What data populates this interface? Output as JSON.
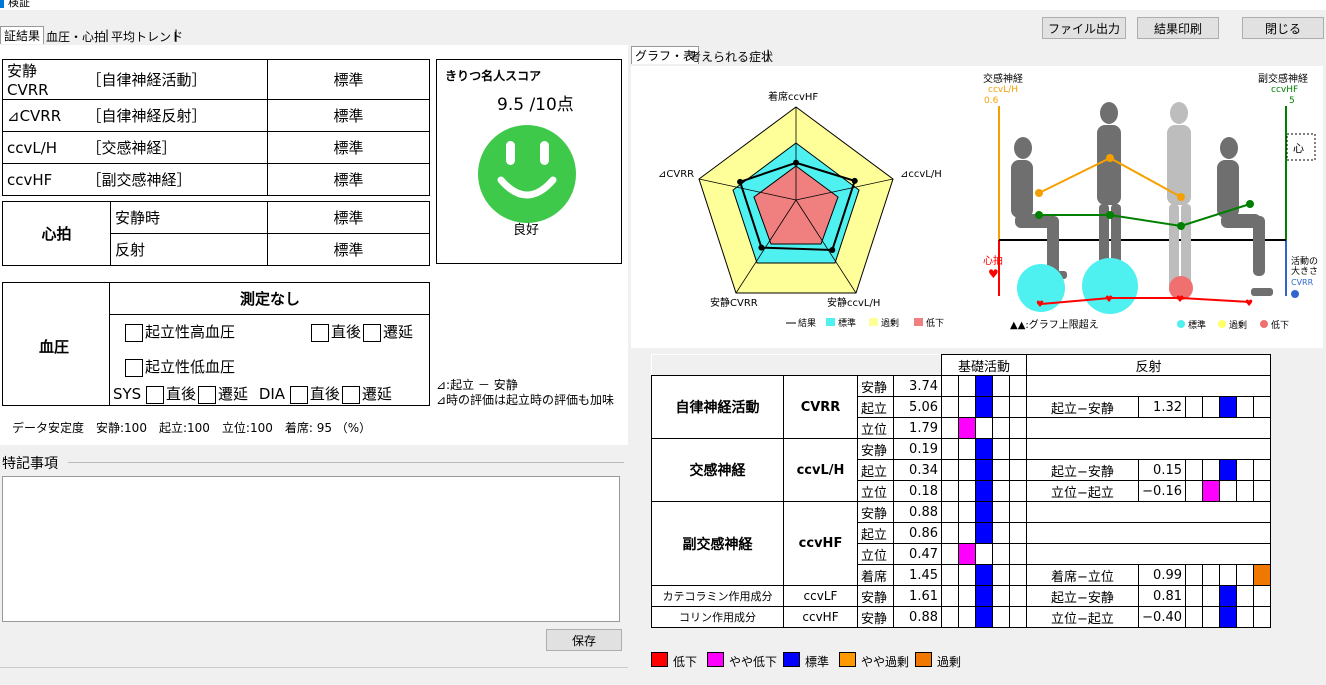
{
  "title_bar": {
    "title": "検証"
  },
  "buttons": {
    "export": "ファイル出力",
    "print": "結果印刷",
    "close": "閉じる",
    "save": "保存"
  },
  "left_tabs": [
    "証結果",
    "血圧・心拍",
    "平均トレンド"
  ],
  "summary": {
    "rows": [
      {
        "name": "安静CVRR",
        "desc": "［自律神経活動］",
        "status": "標準"
      },
      {
        "name": "⊿CVRR",
        "desc": "［自律神経反射］",
        "status": "標準"
      },
      {
        "name": "ccvL/H",
        "desc": "［交感神経］",
        "status": "標準"
      },
      {
        "name": "ccvHF",
        "desc": "［副交感神経］",
        "status": "標準"
      }
    ]
  },
  "score": {
    "title": "きりつ名人スコア",
    "value": "9.5 /10点",
    "label": "良好",
    "face_color": "#3ec94b"
  },
  "heart": {
    "label": "心拍",
    "rows": [
      {
        "name": "安静時",
        "status": "標準"
      },
      {
        "name": "反射",
        "status": "標準"
      }
    ]
  },
  "bp": {
    "label": "血圧",
    "status": "測定なし",
    "high": "起立性高血圧",
    "low": "起立性低血圧",
    "immediate": "直後",
    "delayed": "遷延",
    "sys": "SYS",
    "dia": "DIA"
  },
  "notes": {
    "line1": "⊿:起立 － 安静",
    "line2": "⊿時の評価は起立時の評価も加味"
  },
  "stability": "データ安定度　安静:100　起立:100　立位:100　着席: 95 （%）",
  "special": {
    "label": "特記事項",
    "text": ""
  },
  "right_tabs": [
    "グラフ・表",
    "考えられる症状"
  ],
  "radar": {
    "axes": [
      "着席ccvHF",
      "⊿ccvL/H",
      "安静ccvL/H",
      "安静CVRR",
      "⊿CVRR"
    ],
    "legend": [
      "結果",
      "標準",
      "過剰",
      "低下"
    ],
    "result_levels": [
      0.38,
      0.63,
      0.63,
      0.6,
      0.6
    ],
    "colors": {
      "excess": "#ffff99",
      "standard": "#4ff0f0",
      "low": "#f08080"
    }
  },
  "posture": {
    "sym_label": "交感神経",
    "sym_sub": "ccvL/H",
    "sym_value": "0.6",
    "para_label": "副交感神経",
    "para_sub": "ccvHF",
    "para_value": "5",
    "hr_label": "心拍",
    "size_label1": "活動の",
    "size_label2": "大きさ",
    "size_sub": "CVRR",
    "over_note": "▲▲:グラフ上限超え",
    "legend": [
      "標準",
      "過剰",
      "低下"
    ],
    "colors": {
      "sym": "#f5a000",
      "para": "#008000",
      "hr": "#ff0000",
      "cvrr": "#3366cc"
    }
  },
  "table": {
    "headers": {
      "basic": "基礎活動",
      "reflex": "反射"
    },
    "groups": [
      {
        "name": "自律神経活動",
        "index": "CVRR",
        "rows": [
          {
            "pos": "安静",
            "val": "3.74",
            "level": "standard",
            "r_label": "",
            "r_val": "",
            "r_level": ""
          },
          {
            "pos": "起立",
            "val": "5.06",
            "level": "standard",
            "r_label": "起立−安静",
            "r_val": "1.32",
            "r_level": "standard"
          },
          {
            "pos": "立位",
            "val": "1.79",
            "level": "slightly_low",
            "r_label": "",
            "r_val": "",
            "r_level": ""
          }
        ]
      },
      {
        "name": "交感神経",
        "index": "ccvL/H",
        "rows": [
          {
            "pos": "安静",
            "val": "0.19",
            "level": "standard",
            "r_label": "",
            "r_val": "",
            "r_level": ""
          },
          {
            "pos": "起立",
            "val": "0.34",
            "level": "standard",
            "r_label": "起立−安静",
            "r_val": "0.15",
            "r_level": "standard"
          },
          {
            "pos": "立位",
            "val": "0.18",
            "level": "standard",
            "r_label": "立位−起立",
            "r_val": "−0.16",
            "r_level": "slightly_low"
          }
        ]
      },
      {
        "name": "副交感神経",
        "index": "ccvHF",
        "rows": [
          {
            "pos": "安静",
            "val": "0.88",
            "level": "standard",
            "r_label": "",
            "r_val": "",
            "r_level": ""
          },
          {
            "pos": "起立",
            "val": "0.86",
            "level": "standard",
            "r_label": "",
            "r_val": "",
            "r_level": ""
          },
          {
            "pos": "立位",
            "val": "0.47",
            "level": "slightly_low",
            "r_label": "",
            "r_val": "",
            "r_level": ""
          },
          {
            "pos": "着席",
            "val": "1.45",
            "level": "standard",
            "r_label": "着席−立位",
            "r_val": "0.99",
            "r_level": "excess"
          }
        ]
      },
      {
        "name": "カテコラミン作用成分",
        "index": "ccvLF",
        "rows": [
          {
            "pos": "安静",
            "val": "1.61",
            "level": "standard",
            "r_label": "起立−安静",
            "r_val": "0.81",
            "r_level": "standard"
          }
        ]
      },
      {
        "name": "コリン作用成分",
        "index": "ccvHF",
        "rows": [
          {
            "pos": "安静",
            "val": "0.88",
            "level": "standard",
            "r_label": "立位−起立",
            "r_val": "−0.40",
            "r_level": "standard"
          }
        ]
      }
    ]
  },
  "level_legend": [
    {
      "key": "low",
      "label": "低下",
      "color": "#ff0000"
    },
    {
      "key": "slightly_low",
      "label": "やや低下",
      "color": "#ff00ff"
    },
    {
      "key": "standard",
      "label": "標準",
      "color": "#0000ff"
    },
    {
      "key": "slightly_excess",
      "label": "やや過剰",
      "color": "#ff9900"
    },
    {
      "key": "excess",
      "label": "過剰",
      "color": "#f07800"
    }
  ]
}
